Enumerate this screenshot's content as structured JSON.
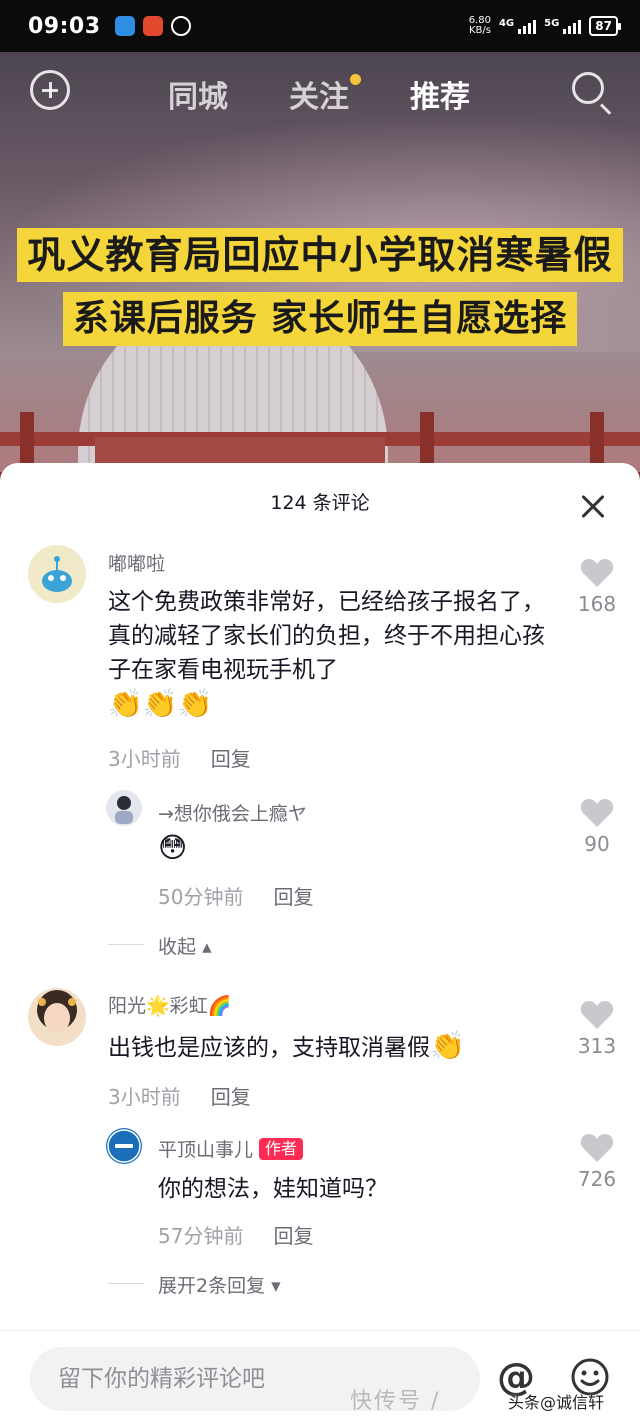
{
  "status_bar": {
    "time": "09:03",
    "net_speed_value": "6.80",
    "net_speed_unit": "KB/s",
    "signal1": "4G",
    "signal2": "5G",
    "battery": "87"
  },
  "top_nav": {
    "tabs": [
      "同城",
      "关注",
      "推荐"
    ],
    "active_tab": "推荐"
  },
  "video": {
    "headline_1": "巩义教育局回应中小学取消寒暑假",
    "headline_2": "系课后服务 家长师生自愿选择"
  },
  "comments_sheet": {
    "title": "124 条评论",
    "comments": [
      {
        "username": "嘟嘟啦",
        "text": "这个免费政策非常好，已经给孩子报名了，真的减轻了家长们的负担，终于不用担心孩子在家看电视玩手机了",
        "emojis": "👏👏👏",
        "time": "3小时前",
        "reply_label": "回复",
        "likes": "168",
        "replies": [
          {
            "username": "→想你俄会上瘾ヤ",
            "text": "😳",
            "time": "50分钟前",
            "reply_label": "回复",
            "likes": "90"
          }
        ],
        "collapse_label": "收起"
      },
      {
        "username": "阳光🌟彩虹🌈",
        "text": "出钱也是应该的，支持取消暑假",
        "emojis": "👏",
        "time": "3小时前",
        "reply_label": "回复",
        "likes": "313",
        "replies": [
          {
            "username": "平顶山事儿",
            "badge": "作者",
            "text": "你的想法，娃知道吗？",
            "time": "57分钟前",
            "reply_label": "回复",
            "likes": "726"
          }
        ],
        "expand_label": "展开2条回复"
      }
    ]
  },
  "bottom_bar": {
    "input_placeholder": "留下你的精彩评论吧",
    "at_symbol": "@",
    "watermark": "快传号 /",
    "watermark_source": "头条@诚信轩"
  },
  "colors": {
    "accent_red": "#fe2c55",
    "headline_yellow": "#f4d63a",
    "notification_dot": "#f7c33a"
  }
}
